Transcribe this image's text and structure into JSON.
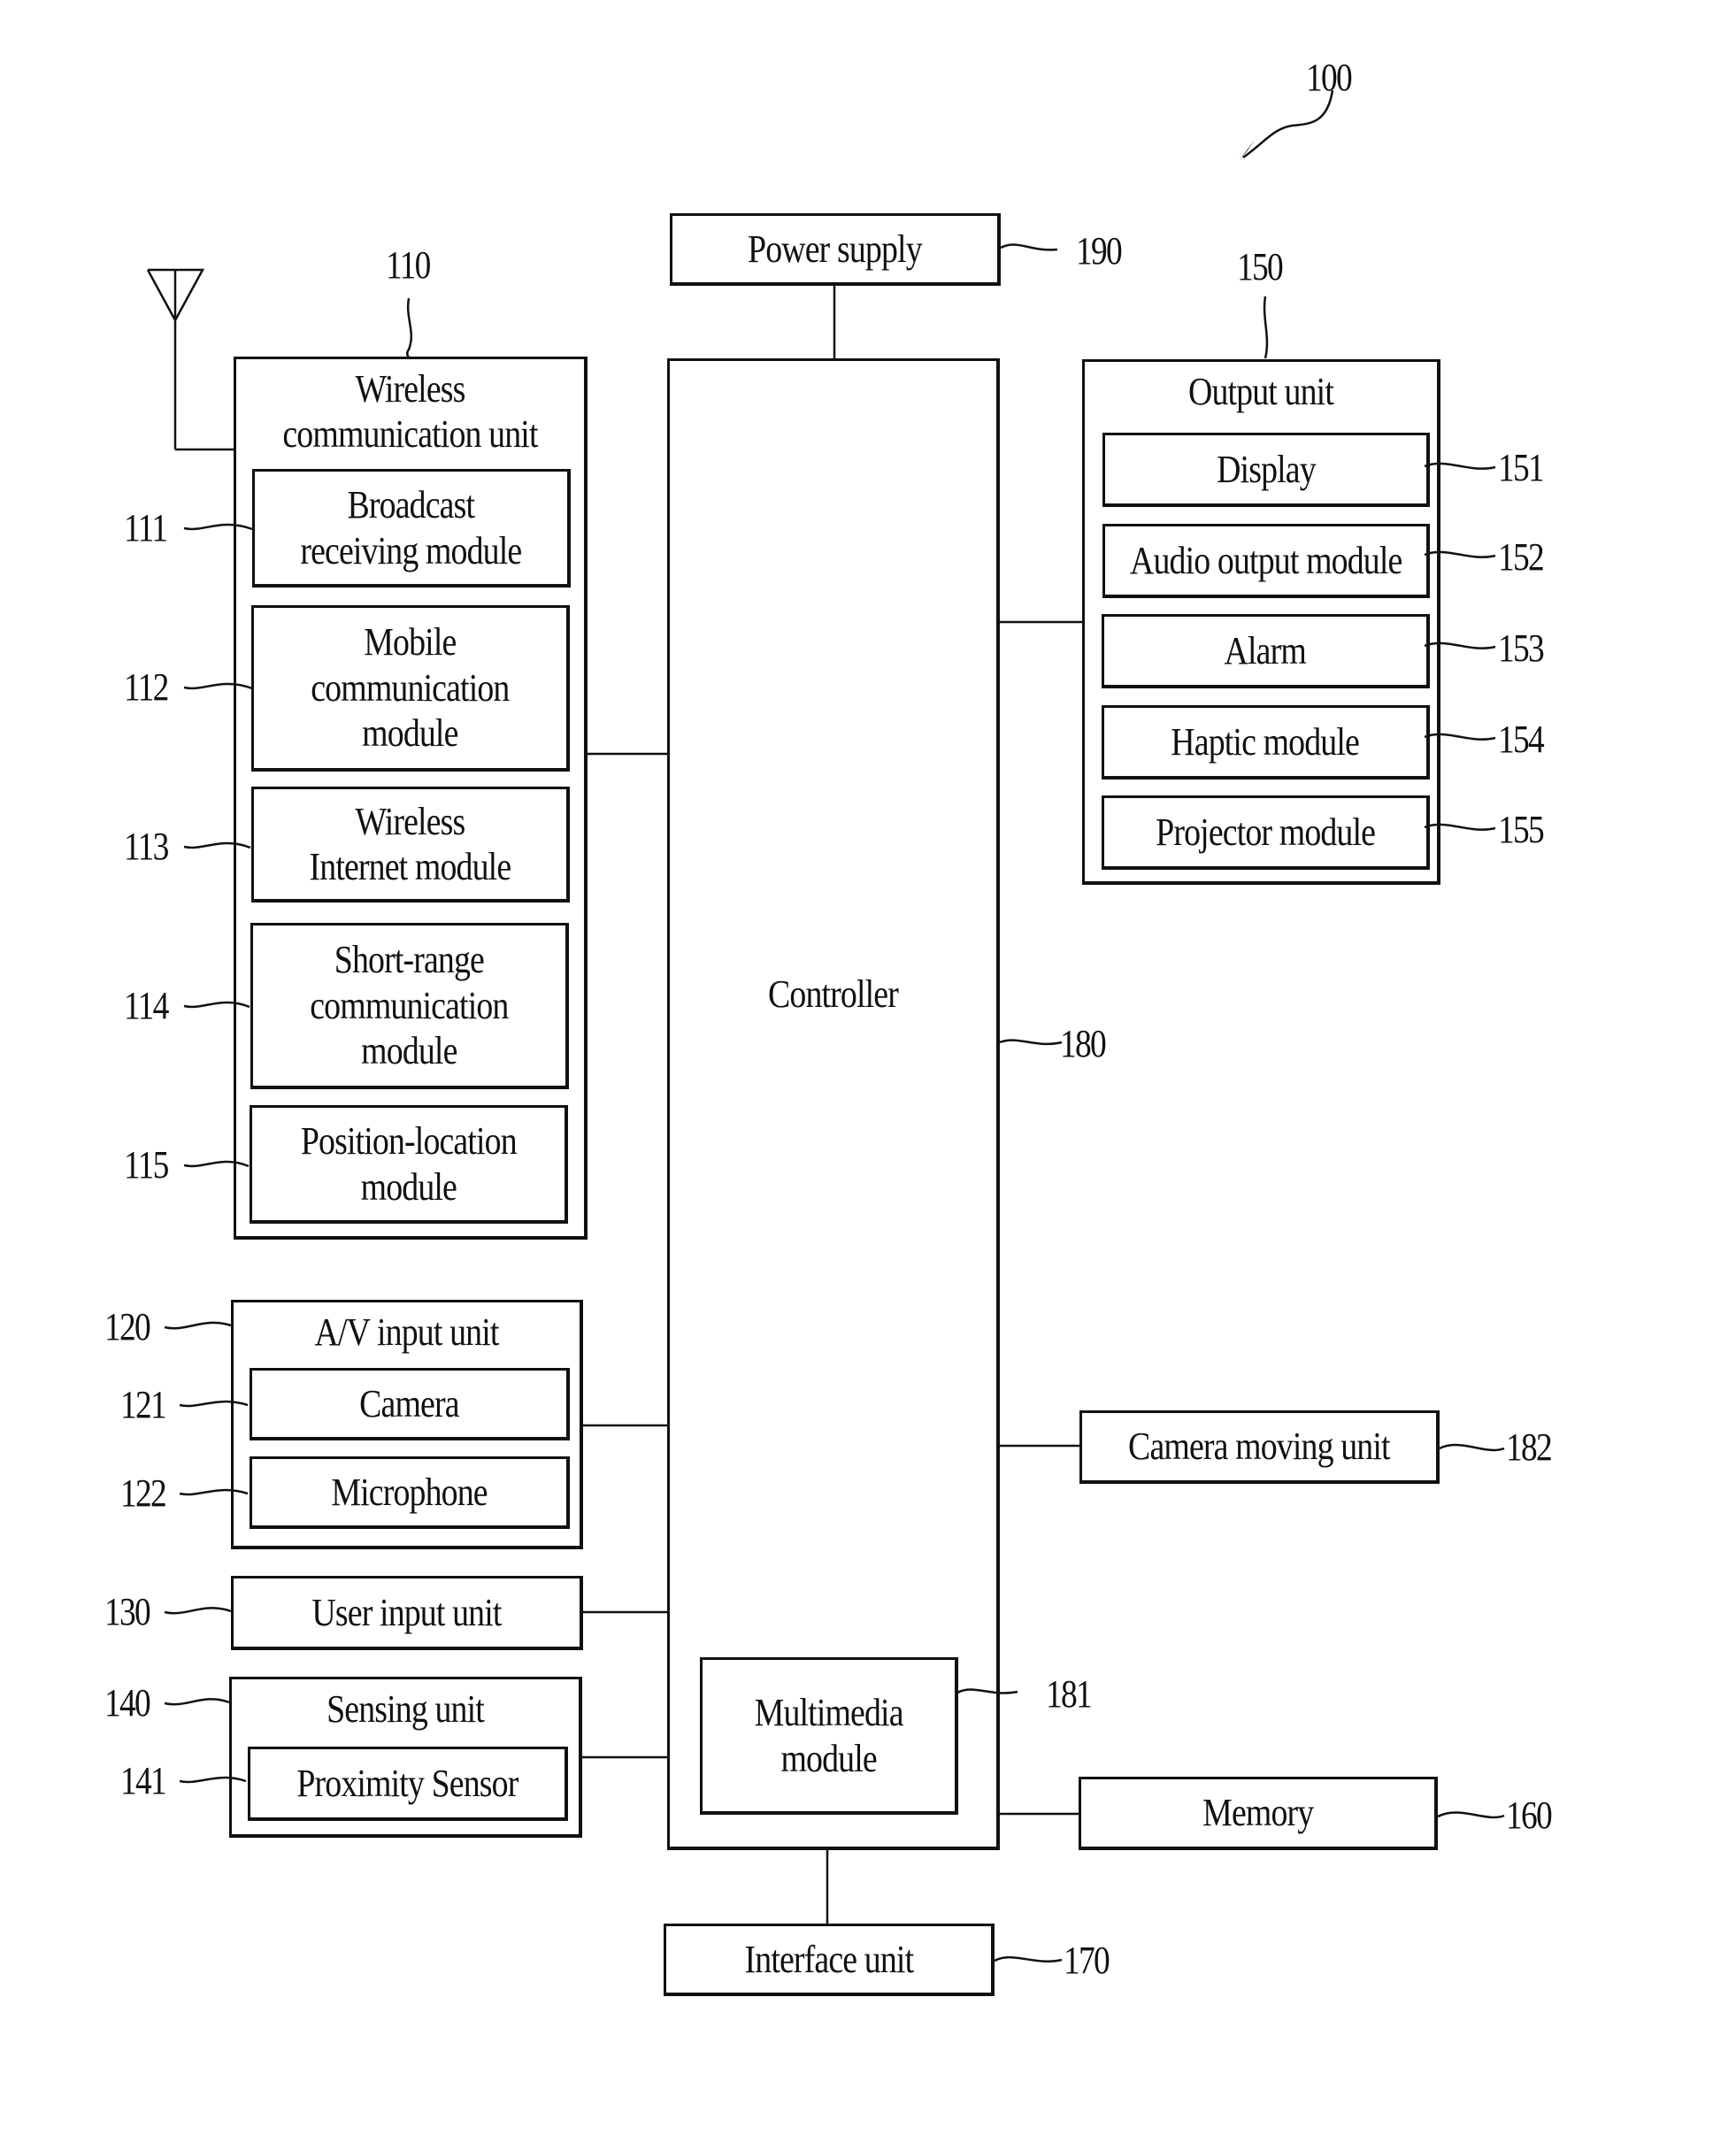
{
  "figure": {
    "reference": "100",
    "power_supply": {
      "label": "Power supply",
      "ref": "190"
    },
    "controller": {
      "label": "Controller",
      "ref": "180",
      "multimedia_module": {
        "label": "Multimedia\nmodule",
        "ref": "181"
      }
    },
    "wireless_unit": {
      "label": "Wireless\ncommunication unit",
      "ref": "110",
      "modules": [
        {
          "label": "Broadcast\nreceiving module",
          "ref": "111"
        },
        {
          "label": "Mobile\ncommunication\nmodule",
          "ref": "112"
        },
        {
          "label": "Wireless\nInternet module",
          "ref": "113"
        },
        {
          "label": "Short-range\ncommunication\nmodule",
          "ref": "114"
        },
        {
          "label": "Position-location\nmodule",
          "ref": "115"
        }
      ]
    },
    "output_unit": {
      "label": "Output unit",
      "ref": "150",
      "modules": [
        {
          "label": "Display",
          "ref": "151"
        },
        {
          "label": "Audio output module",
          "ref": "152"
        },
        {
          "label": "Alarm",
          "ref": "153"
        },
        {
          "label": "Haptic module",
          "ref": "154"
        },
        {
          "label": "Projector module",
          "ref": "155"
        }
      ]
    },
    "av_input_unit": {
      "label": "A/V input unit",
      "ref": "120",
      "modules": [
        {
          "label": "Camera",
          "ref": "121"
        },
        {
          "label": "Microphone",
          "ref": "122"
        }
      ]
    },
    "user_input_unit": {
      "label": "User input unit",
      "ref": "130"
    },
    "sensing_unit": {
      "label": "Sensing unit",
      "ref": "140",
      "modules": [
        {
          "label": "Proximity Sensor",
          "ref": "141"
        }
      ]
    },
    "camera_moving_unit": {
      "label": "Camera moving unit",
      "ref": "182"
    },
    "memory": {
      "label": "Memory",
      "ref": "160"
    },
    "interface_unit": {
      "label": "Interface unit",
      "ref": "170"
    }
  }
}
